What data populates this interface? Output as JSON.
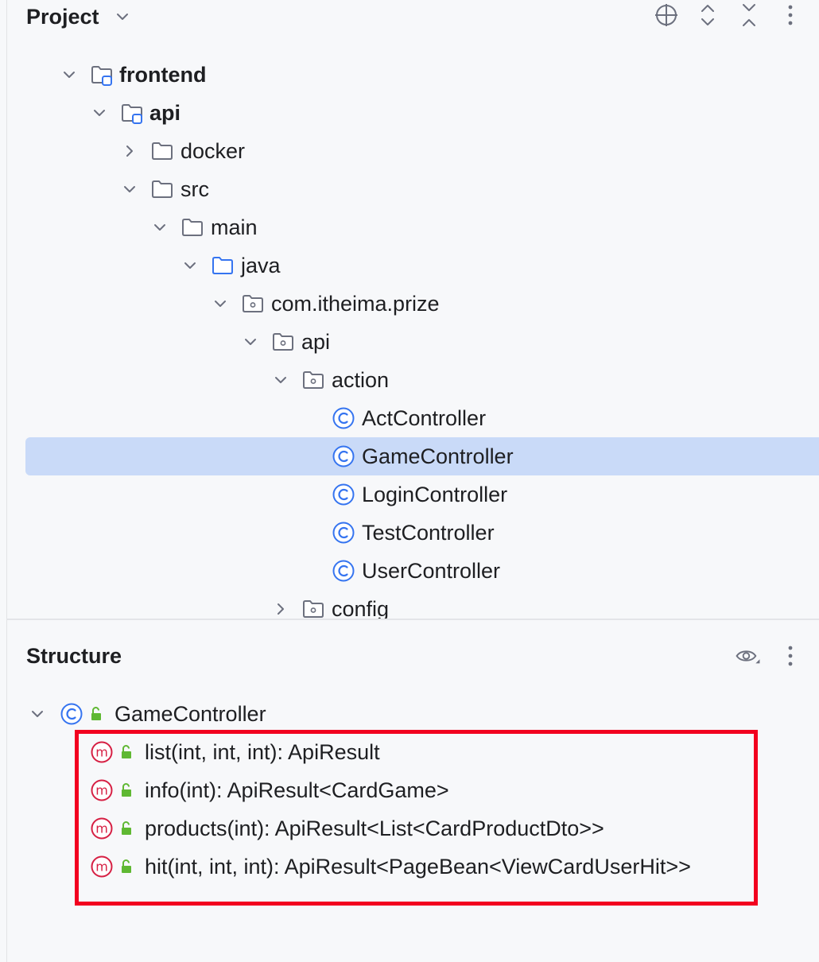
{
  "project_panel": {
    "title": "Project",
    "icons": [
      "chevron-down-icon",
      "locate-icon",
      "expand-all-icon",
      "collapse-all-icon",
      "more-options-icon"
    ]
  },
  "tree": [
    {
      "label": "frontend",
      "depth": 0,
      "expanded": true,
      "icon": "module-folder-icon",
      "bold": true
    },
    {
      "label": "api",
      "depth": 1,
      "expanded": true,
      "icon": "module-folder-icon",
      "bold": true
    },
    {
      "label": "docker",
      "depth": 2,
      "expanded": false,
      "icon": "folder-icon"
    },
    {
      "label": "src",
      "depth": 2,
      "expanded": true,
      "icon": "folder-icon"
    },
    {
      "label": "main",
      "depth": 3,
      "expanded": true,
      "icon": "folder-icon"
    },
    {
      "label": "java",
      "depth": 4,
      "expanded": true,
      "icon": "source-folder-icon"
    },
    {
      "label": "com.itheima.prize",
      "depth": 5,
      "expanded": true,
      "icon": "package-icon"
    },
    {
      "label": "api",
      "depth": 6,
      "expanded": true,
      "icon": "package-icon"
    },
    {
      "label": "action",
      "depth": 7,
      "expanded": true,
      "icon": "package-icon"
    },
    {
      "label": "ActController",
      "depth": 8,
      "icon": "class-icon"
    },
    {
      "label": "GameController",
      "depth": 8,
      "icon": "class-icon",
      "selected": true
    },
    {
      "label": "LoginController",
      "depth": 8,
      "icon": "class-icon"
    },
    {
      "label": "TestController",
      "depth": 8,
      "icon": "class-icon"
    },
    {
      "label": "UserController",
      "depth": 8,
      "icon": "class-icon"
    },
    {
      "label": "config",
      "depth": 7,
      "expanded": false,
      "icon": "package-icon"
    }
  ],
  "structure_panel": {
    "title": "Structure",
    "icons": [
      "eye-icon",
      "more-options-icon"
    ],
    "root": {
      "label": "GameController",
      "icon": "class-icon",
      "visibility": "public"
    },
    "members": [
      {
        "signature": "list(int, int, int): ApiResult",
        "icon": "method-icon",
        "visibility": "public"
      },
      {
        "signature": "info(int): ApiResult<CardGame>",
        "icon": "method-icon",
        "visibility": "public"
      },
      {
        "signature": "products(int): ApiResult<List<CardProductDto>>",
        "icon": "method-icon",
        "visibility": "public"
      },
      {
        "signature": "hit(int, int, int): ApiResult<PageBean<ViewCardUserHit>>",
        "icon": "method-icon",
        "visibility": "public"
      }
    ]
  },
  "colors": {
    "selection": "#c9daf8",
    "highlight_border": "#f2001f",
    "class_icon": "#3574f0",
    "method_icon": "#d61f43",
    "lock_icon": "#5fb832"
  }
}
